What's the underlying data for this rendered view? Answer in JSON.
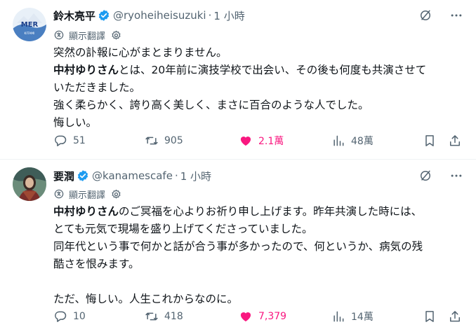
{
  "tweets": [
    {
      "name": "鈴木亮平",
      "handle": "@ryoheiheisuzuki",
      "separator": "·",
      "time": "1 小時",
      "translate_label": "顯示翻譯",
      "avatar_text": "MER",
      "avatar_subtext": "KITAMI",
      "lines": [
        [
          {
            "text": "突然の訃報に心がまとまりません。",
            "bold": false
          }
        ],
        [
          {
            "text": "中村ゆりさん",
            "bold": true
          },
          {
            "text": "とは、20年前に演技学校で出会い、その後も何度も共演させて",
            "bold": false
          }
        ],
        [
          {
            "text": "いただきました。",
            "bold": false
          }
        ],
        [
          {
            "text": "強く柔らかく、誇り高く美しく、まさに百合のような人でした。",
            "bold": false
          }
        ],
        [
          {
            "text": "悔しい。",
            "bold": false
          }
        ]
      ],
      "actions": {
        "replies": "51",
        "reposts": "905",
        "likes": "2.1萬",
        "views": "48萬"
      }
    },
    {
      "name": "要潤",
      "handle": "@kanamescafe",
      "separator": "·",
      "time": "1 小時",
      "translate_label": "顯示翻譯",
      "lines": [
        [
          {
            "text": "中村ゆりさん",
            "bold": true
          },
          {
            "text": "のご冥福を心よりお祈り申し上げます。昨年共演した時には、",
            "bold": false
          }
        ],
        [
          {
            "text": "とても元気で現場を盛り上げてくださっていました。",
            "bold": false
          }
        ],
        [
          {
            "text": "同年代という事で何かと話が合う事が多かったので、何というか、病気の残",
            "bold": false
          }
        ],
        [
          {
            "text": "酷さを恨みます。",
            "bold": false
          }
        ],
        [],
        [
          {
            "text": "ただ、悔しい。人生これからなのに。",
            "bold": false
          }
        ]
      ],
      "actions": {
        "replies": "10",
        "reposts": "418",
        "likes": "7,379",
        "views": "14萬"
      }
    }
  ],
  "icons": {
    "verified": "verified-badge-icon",
    "grok": "grok-icon",
    "more": "more-icon",
    "translate": "translate-icon",
    "settings": "gear-icon",
    "reply": "reply-icon",
    "repost": "repost-icon",
    "like": "heart-icon",
    "views": "views-icon",
    "bookmark": "bookmark-icon",
    "share": "share-icon"
  },
  "colors": {
    "text": "#0f1419",
    "secondary": "#536471",
    "like": "#f91880",
    "verified": "#1d9bf0",
    "divider": "#eff3f4"
  }
}
